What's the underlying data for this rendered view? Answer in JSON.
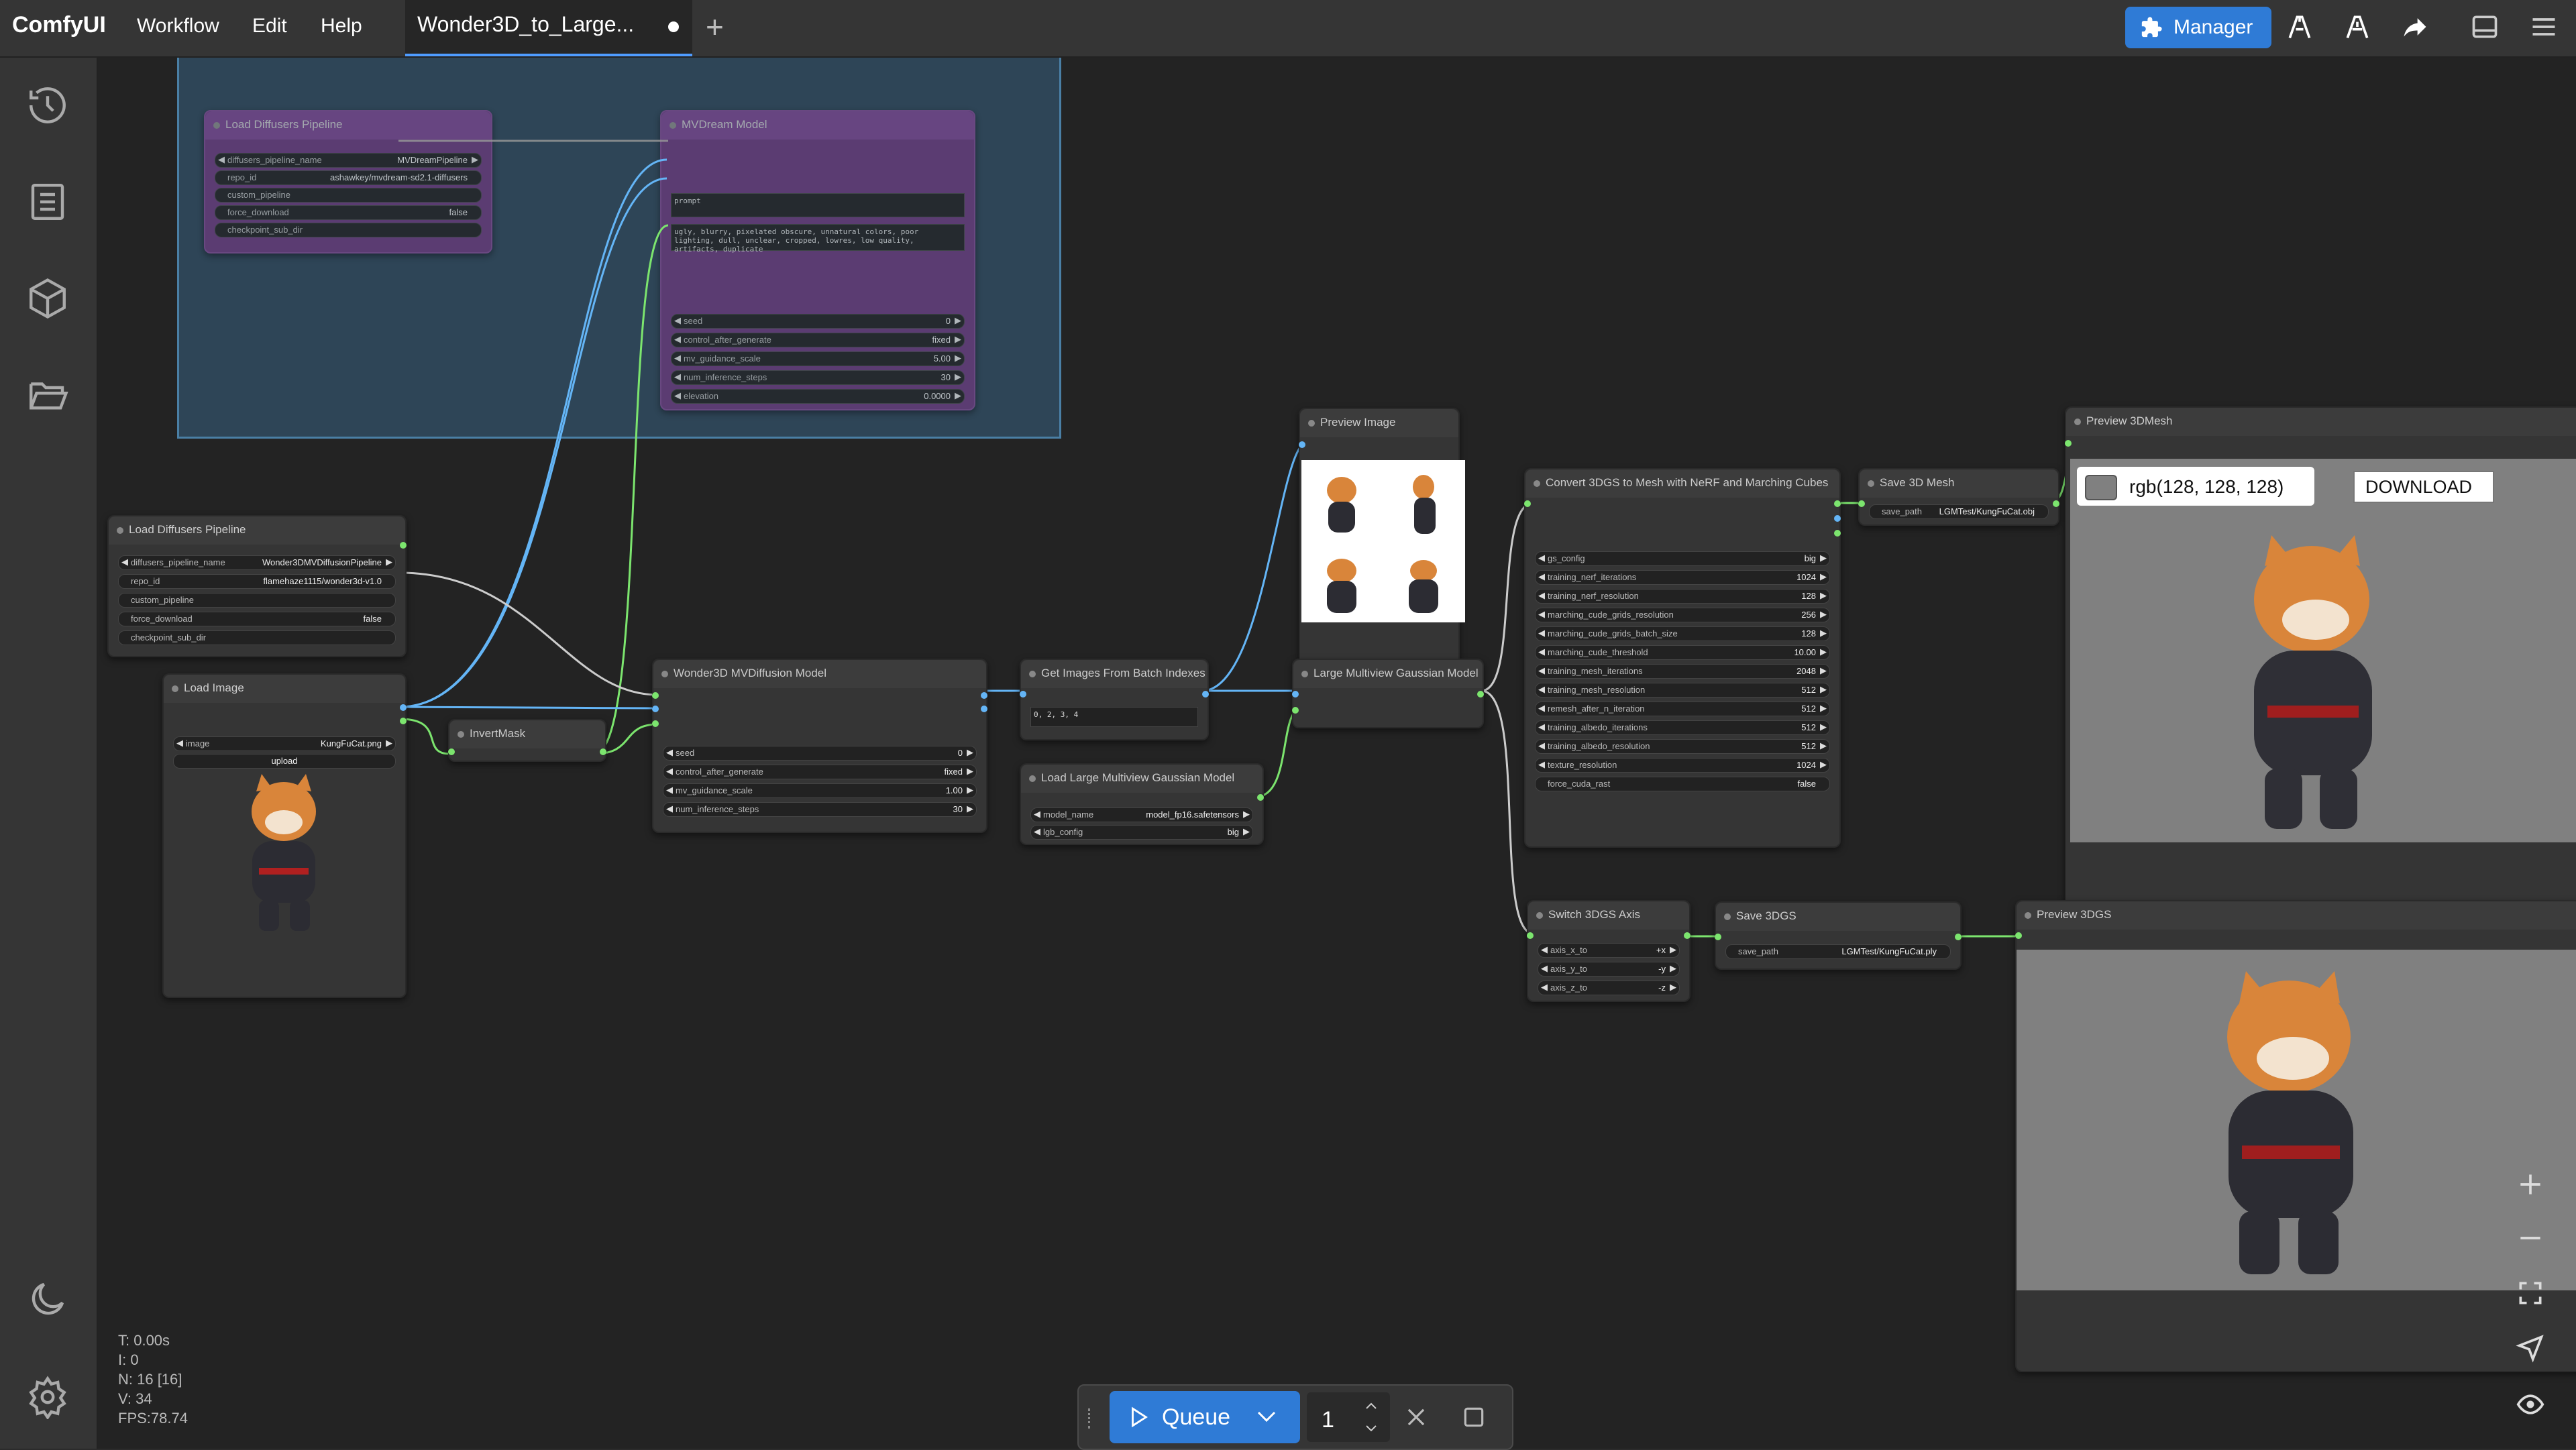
{
  "app": {
    "logo": "ComfyUI",
    "menus": [
      "Workflow",
      "Edit",
      "Help"
    ],
    "tab_title": "Wonder3D_to_Large...",
    "manager_label": "Manager"
  },
  "sidebar": {
    "icons": [
      "history-icon",
      "queue-list-icon",
      "model-library-icon",
      "workflows-folder-icon",
      "theme-moon-icon",
      "settings-gear-icon"
    ]
  },
  "stats": {
    "t": "T: 0.00s",
    "i": "I: 0",
    "n": "N: 16 [16]",
    "v": "V: 34",
    "fps": "FPS:78.74"
  },
  "queue": {
    "label": "Queue",
    "count": "1"
  },
  "nodes": {
    "group_faded_1": {
      "title": "Load Diffusers Pipeline",
      "widgets": [
        {
          "label": "diffusers_pipeline_name",
          "value": "MVDreamPipeline"
        },
        {
          "label": "repo_id",
          "value": "ashawkey/mvdream-sd2.1-diffusers"
        },
        {
          "label": "custom_pipeline",
          "value": ""
        },
        {
          "label": "force_download",
          "value": "false"
        },
        {
          "label": "checkpoint_sub_dir",
          "value": ""
        }
      ]
    },
    "group_faded_2": {
      "title": "MVDream Model",
      "prompt_label": "prompt",
      "negative": "ugly, blurry, pixelated obscure, unnatural colors, poor lighting, dull, unclear, cropped, lowres, low quality, artifacts, duplicate",
      "widgets": [
        {
          "label": "seed",
          "value": "0"
        },
        {
          "label": "control_after_generate",
          "value": "fixed"
        },
        {
          "label": "mv_guidance_scale",
          "value": "5.00"
        },
        {
          "label": "num_inference_steps",
          "value": "30"
        },
        {
          "label": "elevation",
          "value": "0.0000"
        }
      ]
    },
    "load_diffusers": {
      "title": "Load Diffusers Pipeline",
      "widgets": [
        {
          "label": "diffusers_pipeline_name",
          "value": "Wonder3DMVDiffusionPipeline"
        },
        {
          "label": "repo_id",
          "value": "flamehaze1115/wonder3d-v1.0"
        },
        {
          "label": "custom_pipeline",
          "value": ""
        },
        {
          "label": "force_download",
          "value": "false"
        },
        {
          "label": "checkpoint_sub_dir",
          "value": ""
        }
      ]
    },
    "load_image": {
      "title": "Load Image",
      "image_label": "image",
      "image_value": "KungFuCat.png",
      "upload": "upload"
    },
    "invert_mask": {
      "title": "InvertMask"
    },
    "wonder3d": {
      "title": "Wonder3D MVDiffusion Model",
      "widgets": [
        {
          "label": "seed",
          "value": "0"
        },
        {
          "label": "control_after_generate",
          "value": "fixed"
        },
        {
          "label": "mv_guidance_scale",
          "value": "1.00"
        },
        {
          "label": "num_inference_steps",
          "value": "30"
        }
      ]
    },
    "get_images": {
      "title": "Get Images From Batch Indexes",
      "indexes": "0, 2, 3, 4"
    },
    "load_lgm": {
      "title": "Load Large Multiview Gaussian Model",
      "widgets": [
        {
          "label": "model_name",
          "value": "model_fp16.safetensors"
        },
        {
          "label": "lgb_config",
          "value": "big"
        }
      ]
    },
    "preview_image": {
      "title": "Preview Image"
    },
    "lgm": {
      "title": "Large Multiview Gaussian Model"
    },
    "convert": {
      "title": "Convert 3DGS to Mesh with NeRF and Marching Cubes",
      "widgets": [
        {
          "label": "gs_config",
          "value": "big"
        },
        {
          "label": "training_nerf_iterations",
          "value": "1024"
        },
        {
          "label": "training_nerf_resolution",
          "value": "128"
        },
        {
          "label": "marching_cude_grids_resolution",
          "value": "256"
        },
        {
          "label": "marching_cude_grids_batch_size",
          "value": "128"
        },
        {
          "label": "marching_cude_threshold",
          "value": "10.00"
        },
        {
          "label": "training_mesh_iterations",
          "value": "2048"
        },
        {
          "label": "training_mesh_resolution",
          "value": "512"
        },
        {
          "label": "remesh_after_n_iteration",
          "value": "512"
        },
        {
          "label": "training_albedo_iterations",
          "value": "512"
        },
        {
          "label": "training_albedo_resolution",
          "value": "512"
        },
        {
          "label": "texture_resolution",
          "value": "1024"
        },
        {
          "label": "force_cuda_rast",
          "value": "false"
        }
      ]
    },
    "save_mesh": {
      "title": "Save 3D Mesh",
      "label": "save_path",
      "value": "LGMTest/KungFuCat.obj"
    },
    "preview_mesh": {
      "title": "Preview 3DMesh",
      "color_text": "rgb(128, 128, 128)",
      "download": "DOWNLOAD"
    },
    "switch_axis": {
      "title": "Switch 3DGS Axis",
      "widgets": [
        {
          "label": "axis_x_to",
          "value": "+x"
        },
        {
          "label": "axis_y_to",
          "value": "-y"
        },
        {
          "label": "axis_z_to",
          "value": "-z"
        }
      ]
    },
    "save_3dgs": {
      "title": "Save 3DGS",
      "label": "save_path",
      "value": "LGMTest/KungFuCat.ply"
    },
    "preview_3dgs": {
      "title": "Preview 3DGS"
    }
  }
}
